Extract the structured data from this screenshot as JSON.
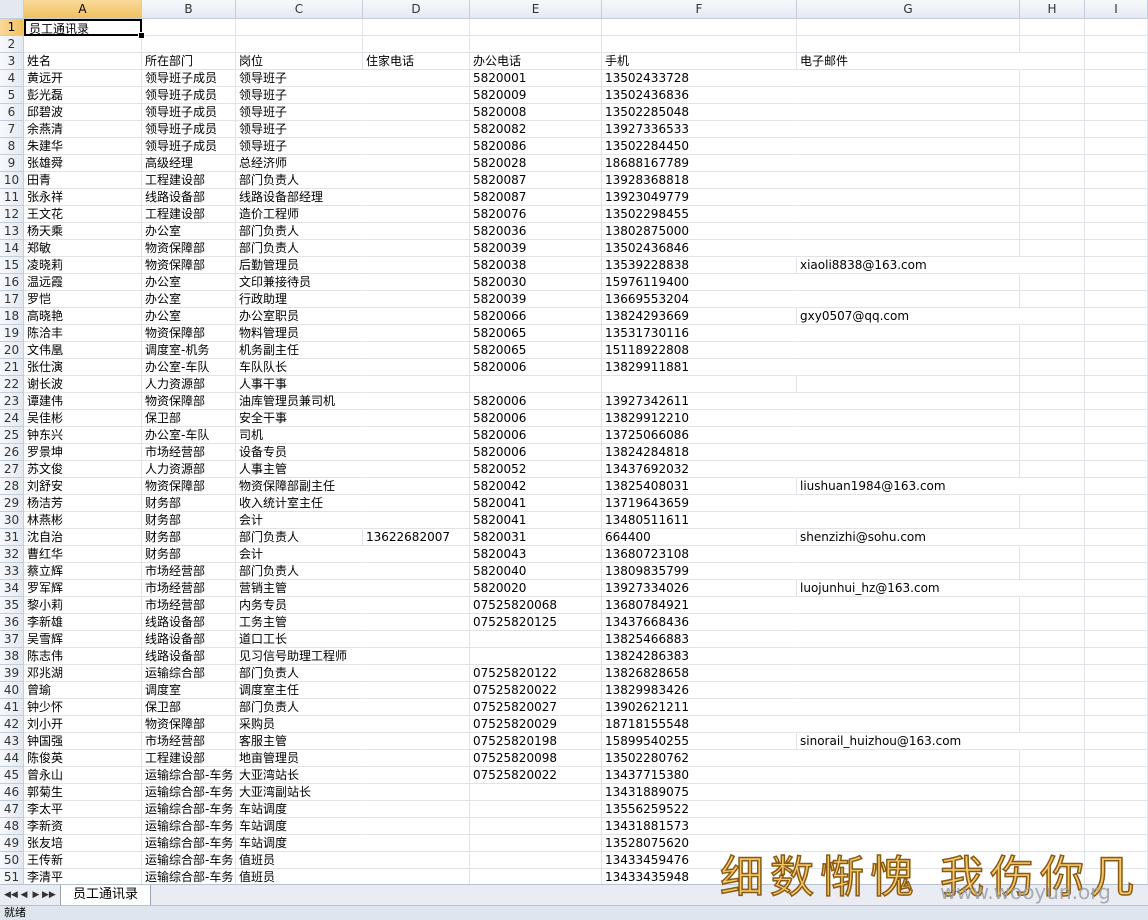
{
  "columns": [
    "A",
    "B",
    "C",
    "D",
    "E",
    "F",
    "G",
    "H",
    "I"
  ],
  "sheet_tab": "员工通讯录",
  "status": "就绪",
  "watermark": {
    "text": "细数惭愧 我伤你几",
    "url": "www.wooyun.org"
  },
  "rows": [
    [
      "员工通讯录",
      "",
      "",
      "",
      "",
      "",
      ""
    ],
    [
      "",
      "",
      "",
      "",
      "",
      "",
      ""
    ],
    [
      "姓名",
      "所在部门",
      "岗位",
      "住家电话",
      "办公电话",
      "手机",
      "电子邮件"
    ],
    [
      "黄远开",
      "领导班子成员",
      "领导班子",
      "",
      "5820001",
      "13502433728",
      ""
    ],
    [
      "彭光磊",
      "领导班子成员",
      "领导班子",
      "",
      "5820009",
      "13502436836",
      ""
    ],
    [
      "邱碧波",
      "领导班子成员",
      "领导班子",
      "",
      "5820008",
      "13502285048",
      ""
    ],
    [
      "余燕清",
      "领导班子成员",
      "领导班子",
      "",
      "5820082",
      "13927336533",
      ""
    ],
    [
      "朱建华",
      "领导班子成员",
      "领导班子",
      "",
      "5820086",
      "13502284450",
      ""
    ],
    [
      "张雄舜",
      "高级经理",
      "总经济师",
      "",
      "5820028",
      "18688167789",
      ""
    ],
    [
      "田青",
      "工程建设部",
      "部门负责人",
      "",
      "5820087",
      "13928368818",
      ""
    ],
    [
      "张永祥",
      "线路设备部",
      "线路设备部经理",
      "",
      "5820087",
      "13923049779",
      ""
    ],
    [
      "王文花",
      "工程建设部",
      "造价工程师",
      "",
      "5820076",
      "13502298455",
      ""
    ],
    [
      "杨天乘",
      "办公室",
      "部门负责人",
      "",
      "5820036",
      "13802875000",
      ""
    ],
    [
      "郑敏",
      "物资保障部",
      "部门负责人",
      "",
      "5820039",
      "13502436846",
      ""
    ],
    [
      "凌晓莉",
      "物资保障部",
      "后勤管理员",
      "",
      "5820038",
      "13539228838",
      "xiaoli8838@163.com"
    ],
    [
      "温远霞",
      "办公室",
      "文印兼接待员",
      "",
      "5820030",
      "15976119400",
      ""
    ],
    [
      "罗恺",
      "办公室",
      "行政助理",
      "",
      "5820039",
      "13669553204",
      ""
    ],
    [
      "高晓艳",
      "办公室",
      "办公室职员",
      "",
      "5820066",
      "13824293669",
      "gxy0507@qq.com"
    ],
    [
      "陈洽丰",
      "物资保障部",
      "物料管理员",
      "",
      "5820065",
      "13531730116",
      ""
    ],
    [
      "文伟凰",
      "调度室-机务",
      "机务副主任",
      "",
      "5820065",
      "15118922808",
      ""
    ],
    [
      "张仕演",
      "办公室-车队",
      "车队队长",
      "",
      "5820006",
      "13829911881",
      ""
    ],
    [
      "谢长波",
      "人力资源部",
      "人事干事",
      "",
      "",
      "",
      ""
    ],
    [
      "谭建伟",
      "物资保障部",
      "油库管理员兼司机",
      "",
      "5820006",
      "13927342611",
      ""
    ],
    [
      "吴佳彬",
      "保卫部",
      "安全干事",
      "",
      "5820006",
      "13829912210",
      ""
    ],
    [
      "钟东兴",
      "办公室-车队",
      "司机",
      "",
      "5820006",
      "13725066086",
      ""
    ],
    [
      "罗景坤",
      "市场经营部",
      "设备专员",
      "",
      "5820006",
      "13824284818",
      ""
    ],
    [
      "苏文俊",
      "人力资源部",
      "人事主管",
      "",
      "5820052",
      "13437692032",
      ""
    ],
    [
      "刘舒安",
      "物资保障部",
      "物资保障部副主任",
      "",
      "5820042",
      "13825408031",
      "liushuan1984@163.com"
    ],
    [
      "杨洁芳",
      "财务部",
      "收入统计室主任",
      "",
      "5820041",
      "13719643659",
      ""
    ],
    [
      "林燕彬",
      "财务部",
      "会计",
      "",
      "5820041",
      "13480511611",
      ""
    ],
    [
      "沈自治",
      "财务部",
      "部门负责人",
      "13622682007",
      "5820031",
      "664400",
      "shenzizhi@sohu.com"
    ],
    [
      "曹红华",
      "财务部",
      "会计",
      "",
      "5820043",
      "13680723108",
      ""
    ],
    [
      "蔡立辉",
      "市场经营部",
      "部门负责人",
      "",
      "5820040",
      "13809835799",
      ""
    ],
    [
      "罗军辉",
      "市场经营部",
      "营销主管",
      "",
      "5820020",
      "13927334026",
      "luojunhui_hz@163.com"
    ],
    [
      "黎小莉",
      "市场经营部",
      "内务专员",
      "",
      "07525820068",
      "13680784921",
      ""
    ],
    [
      "李新雄",
      "线路设备部",
      "工务主管",
      "",
      "07525820125",
      "13437668436",
      ""
    ],
    [
      "吴雪辉",
      "线路设备部",
      "道口工长",
      "",
      "",
      "13825466883",
      ""
    ],
    [
      "陈志伟",
      "线路设备部",
      "见习信号助理工程师",
      "",
      "",
      "13824286383",
      ""
    ],
    [
      "邓兆湖",
      "运输综合部",
      "部门负责人",
      "",
      "07525820122",
      "13826828658",
      ""
    ],
    [
      "曾瑜",
      "调度室",
      "调度室主任",
      "",
      "07525820022",
      "13829983426",
      ""
    ],
    [
      "钟少怀",
      "保卫部",
      "部门负责人",
      "",
      "07525820027",
      "13902621211",
      ""
    ],
    [
      "刘小开",
      "物资保障部",
      "采购员",
      "",
      "07525820029",
      "18718155548",
      ""
    ],
    [
      "钟国强",
      "市场经营部",
      "客服主管",
      "",
      "07525820198",
      "15899540255",
      "sinorail_huizhou@163.com"
    ],
    [
      "陈俊英",
      "工程建设部",
      "地亩管理员",
      "",
      "07525820098",
      "13502280762",
      ""
    ],
    [
      "曾永山",
      "运输综合部-车务",
      "大亚湾站长",
      "",
      "07525820022",
      "13437715380",
      ""
    ],
    [
      "郭菊生",
      "运输综合部-车务",
      "大亚湾副站长",
      "",
      "",
      "13431889075",
      ""
    ],
    [
      "李太平",
      "运输综合部-车务",
      "车站调度",
      "",
      "",
      "13556259522",
      ""
    ],
    [
      "李新资",
      "运输综合部-车务",
      "车站调度",
      "",
      "",
      "13431881573",
      ""
    ],
    [
      "张友培",
      "运输综合部-车务",
      "车站调度",
      "",
      "",
      "13528075620",
      ""
    ],
    [
      "王传新",
      "运输综合部-车务",
      "值班员",
      "",
      "",
      "13433459476",
      ""
    ],
    [
      "李清平",
      "运输综合部-车务",
      "值班员",
      "",
      "",
      "13433435948",
      ""
    ]
  ]
}
